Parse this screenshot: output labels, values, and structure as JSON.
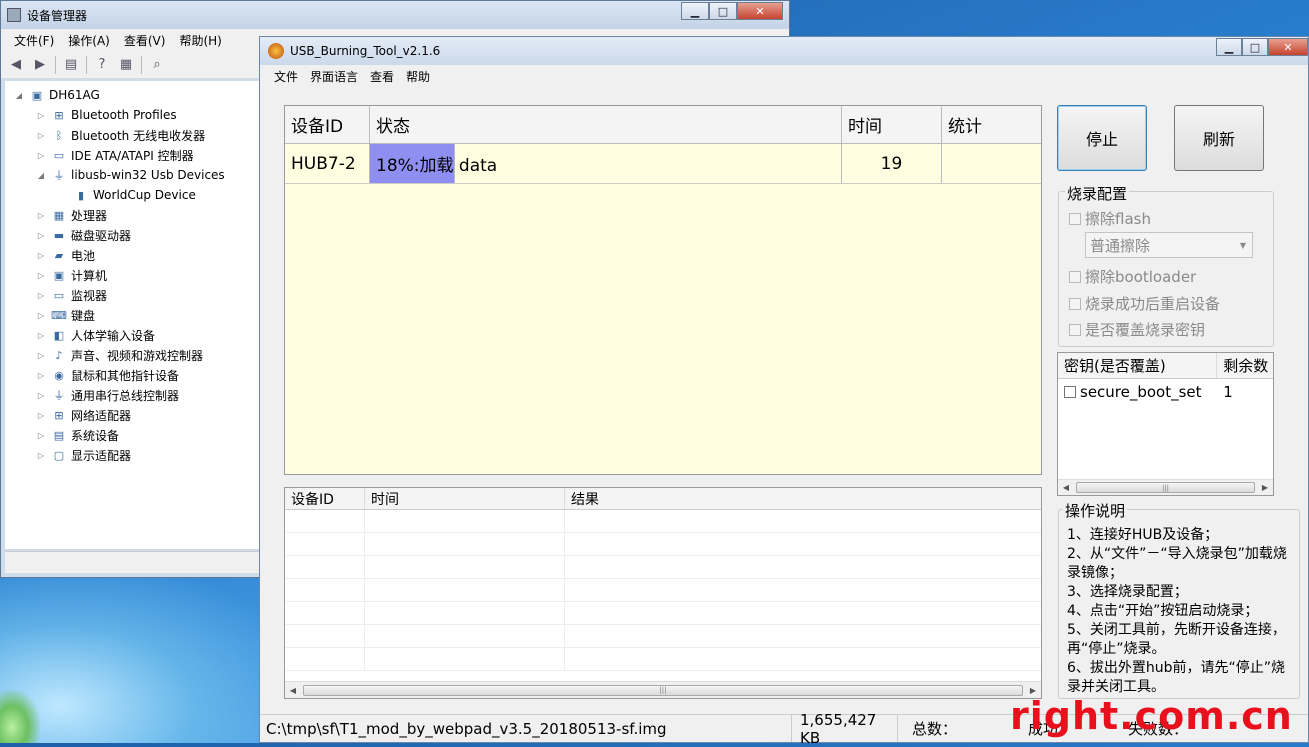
{
  "device_manager": {
    "title": "设备管理器",
    "menu": [
      "文件(F)",
      "操作(A)",
      "查看(V)",
      "帮助(H)"
    ],
    "tree": [
      {
        "label": "DH61AG",
        "arrow": "◢",
        "icon": "computer-icon"
      },
      {
        "label": "Bluetooth Profiles",
        "arrow": "▷",
        "icon": "network-icon"
      },
      {
        "label": "Bluetooth 无线电收发器",
        "arrow": "▷",
        "icon": "bluetooth-icon"
      },
      {
        "label": "IDE ATA/ATAPI 控制器",
        "arrow": "▷",
        "icon": "ide-controller-icon"
      },
      {
        "label": "libusb-win32 Usb Devices",
        "arrow": "◢",
        "icon": "usb-icon"
      },
      {
        "label": "WorldCup Device",
        "arrow": "",
        "icon": "usb-device-icon"
      },
      {
        "label": "处理器",
        "arrow": "▷",
        "icon": "processor-icon"
      },
      {
        "label": "磁盘驱动器",
        "arrow": "▷",
        "icon": "disk-icon"
      },
      {
        "label": "电池",
        "arrow": "▷",
        "icon": "battery-icon"
      },
      {
        "label": "计算机",
        "arrow": "▷",
        "icon": "computer-icon"
      },
      {
        "label": "监视器",
        "arrow": "▷",
        "icon": "monitor-icon"
      },
      {
        "label": "键盘",
        "arrow": "▷",
        "icon": "keyboard-icon"
      },
      {
        "label": "人体学输入设备",
        "arrow": "▷",
        "icon": "hid-icon"
      },
      {
        "label": "声音、视频和游戏控制器",
        "arrow": "▷",
        "icon": "sound-icon"
      },
      {
        "label": "鼠标和其他指针设备",
        "arrow": "▷",
        "icon": "mouse-icon"
      },
      {
        "label": "通用串行总线控制器",
        "arrow": "▷",
        "icon": "usb-icon"
      },
      {
        "label": "网络适配器",
        "arrow": "▷",
        "icon": "network-icon"
      },
      {
        "label": "系统设备",
        "arrow": "▷",
        "icon": "system-icon"
      },
      {
        "label": "显示适配器",
        "arrow": "▷",
        "icon": "display-icon"
      }
    ]
  },
  "usb_tool": {
    "title": "USB_Burning_Tool_v2.1.6",
    "menu": [
      "文件",
      "界面语言",
      "查看",
      "帮助"
    ],
    "grid": {
      "headers": [
        "设备ID",
        "状态",
        "时间",
        "统计"
      ],
      "rows": [
        {
          "device_id": "HUB7-2",
          "status": "18%:加载 data",
          "progress_percent": 18,
          "time": "19",
          "stats": ""
        }
      ]
    },
    "log": {
      "headers": [
        "设备ID",
        "时间",
        "结果"
      ]
    },
    "buttons": {
      "stop": "停止",
      "refresh": "刷新"
    },
    "config": {
      "title": "烧录配置",
      "erase_flash": "擦除flash",
      "erase_mode": "普通擦除",
      "erase_bootloader": "擦除bootloader",
      "reboot_after": "烧录成功后重启设备",
      "overwrite_key": "是否覆盖烧录密钥"
    },
    "keys": {
      "headers": [
        "密钥(是否覆盖)",
        "剩余数"
      ],
      "rows": [
        {
          "name": "secure_boot_set",
          "remaining": "1"
        }
      ]
    },
    "instructions": {
      "title": "操作说明",
      "lines": [
        "1、连接好HUB及设备；",
        "2、从“文件”－“导入烧录包”加载烧录镜像；",
        "3、选择烧录配置；",
        "4、点击“开始”按钮启动烧录；",
        "5、关闭工具前，先断开设备连接，再“停止”烧录。",
        "6、拔出外置hub前，请先“停止”烧录并关闭工具。"
      ]
    },
    "statusbar": {
      "file": "C:\\tmp\\sf\\T1_mod_by_webpad_v3.5_20180513-sf.img",
      "size": "1,655,427 KB",
      "total": "总数：",
      "success": "成功：",
      "fail": "失败数："
    }
  },
  "watermark": "right.com.cn",
  "colors": {
    "progress": "#8f8ff2",
    "grid_bg": "#fffee0",
    "watermark": "#e8101c"
  }
}
